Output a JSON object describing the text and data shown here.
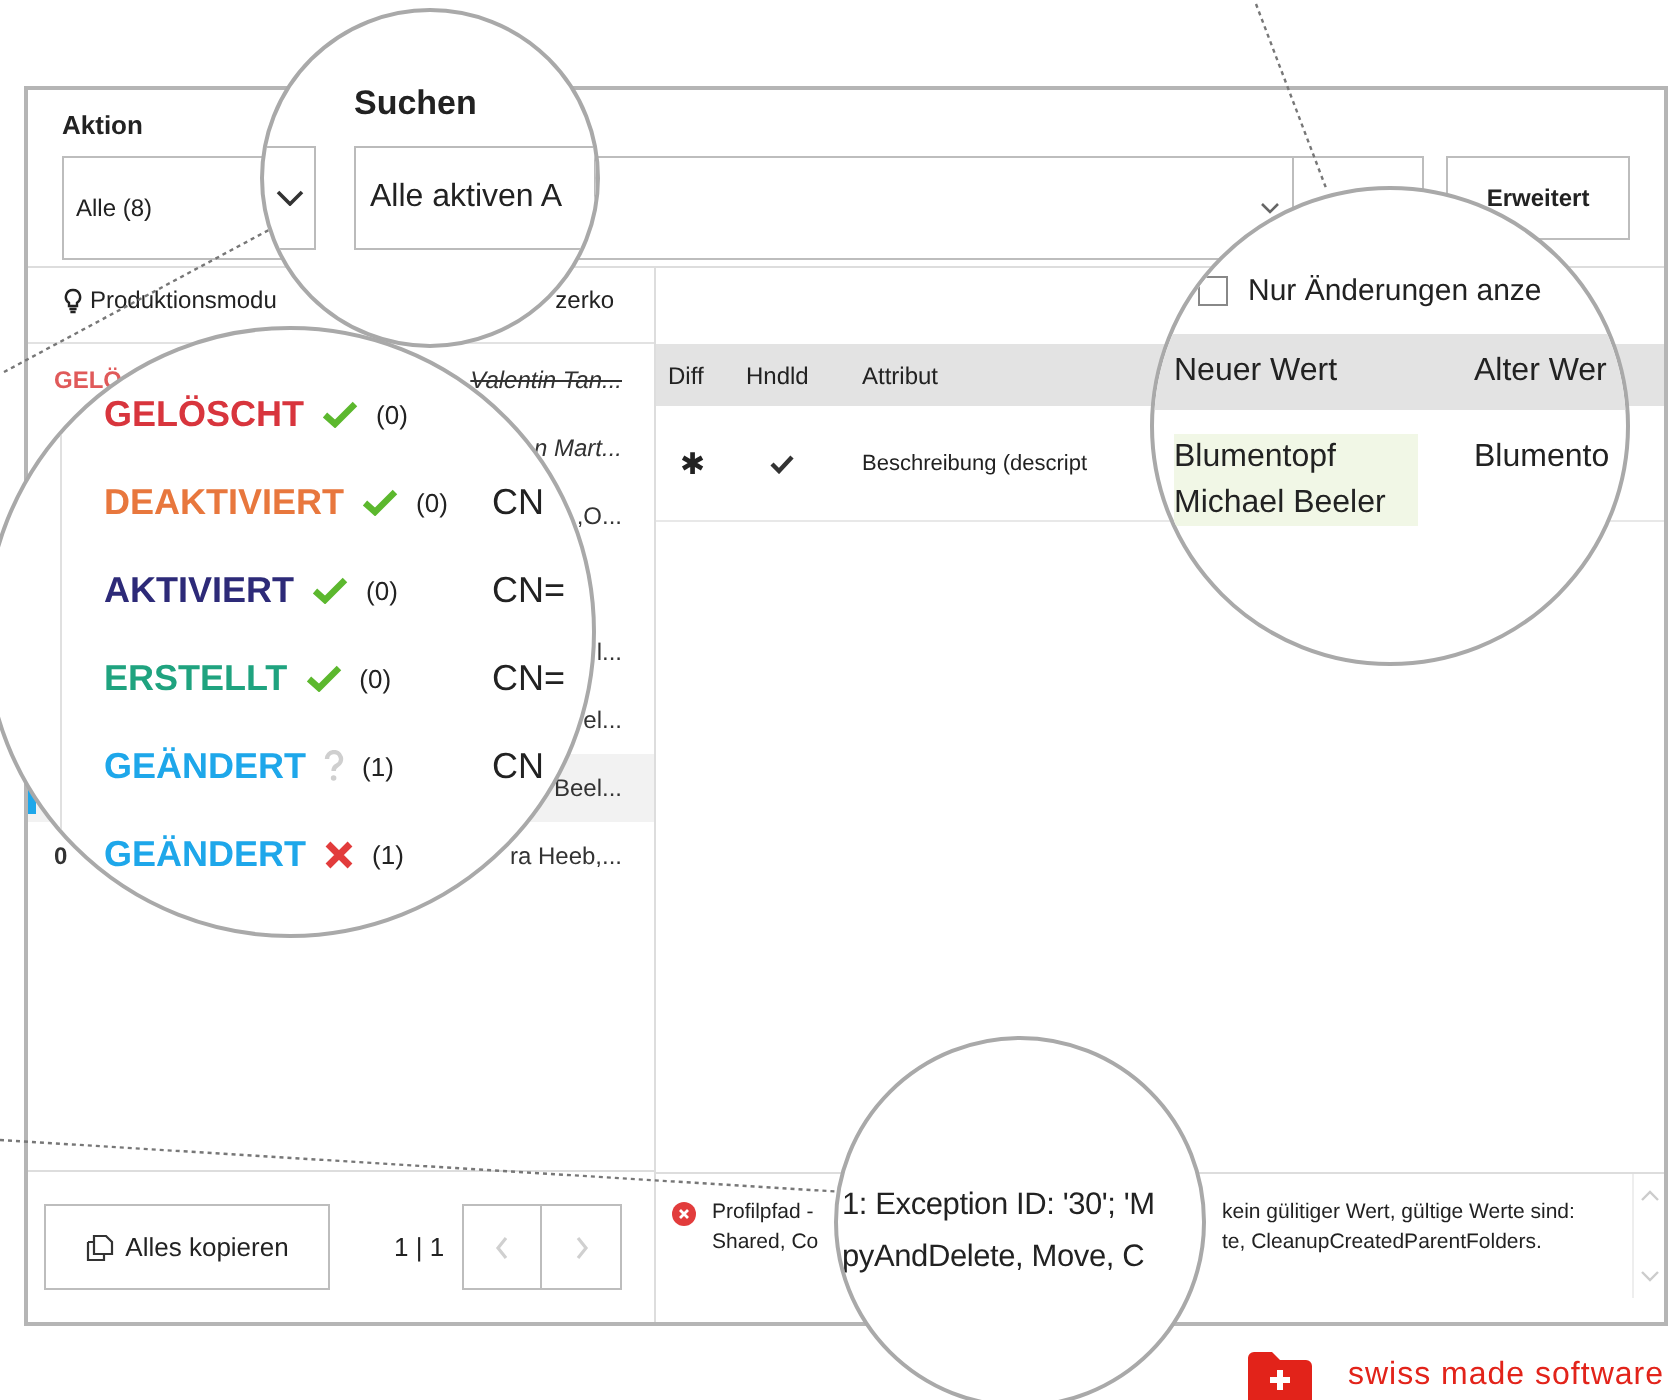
{
  "toolbar": {
    "action_label": "Aktion",
    "action_value": "Alle (8)",
    "advanced_button": "Erweitert"
  },
  "list_header": {
    "module": "Produktionsmodu",
    "user": "zerko"
  },
  "list_rows": [
    {
      "status_fragment": "GELÖ",
      "kind": "deleted",
      "subject": "Valentin Tan...",
      "selected": false
    },
    {
      "kind": "italic",
      "subject": "n Mart...",
      "selected": false
    },
    {
      "kind": "normal",
      "subject": ",O...",
      "selected": false
    },
    {
      "selected": false
    },
    {
      "kind": "normal",
      "subject": "l...",
      "selected": false
    },
    {
      "kind": "normal",
      "subject": "el...",
      "selected": false
    },
    {
      "kind": "normal",
      "subject": "Beel...",
      "selected": true
    },
    {
      "status_fragment": "0",
      "kind": "normal",
      "subject": "ra Heeb,...",
      "selected": false
    }
  ],
  "pager": {
    "copy_button": "Alles kopieren",
    "page": "1 | 1",
    "prev_disabled": true,
    "next_disabled": true
  },
  "detail_table": {
    "columns": [
      "Diff",
      "Hndld",
      "Attribut"
    ],
    "rows": [
      {
        "diff": "✱",
        "handled": true,
        "attribute": "Beschreibung (descript"
      }
    ]
  },
  "message": {
    "kind": "error",
    "line_1_start": "Profilpfad -",
    "line_1_end": "kein gülitiger Wert, gültige Werte sind:",
    "line_2_start": "Shared, Co",
    "line_2_end": "te, CleanupCreatedParentFolders."
  },
  "magnifier_search": {
    "label": "Suchen",
    "value": "Alle aktiven A"
  },
  "magnifier_actions": {
    "items": [
      {
        "label": "GELÖSCHT",
        "color": "#d8353d",
        "kind": "check",
        "count": "(0)"
      },
      {
        "label": "DEAKTIVIERT",
        "color": "#e8773d",
        "kind": "check",
        "count": "(0)",
        "subject": "CN"
      },
      {
        "label": "AKTIVIERT",
        "color": "#2d2a78",
        "kind": "check",
        "count": "(0)",
        "subject": "CN="
      },
      {
        "label": "ERSTELLT",
        "color": "#1fa37f",
        "kind": "check",
        "count": "(0)",
        "subject": "CN="
      },
      {
        "label": "GEÄNDERT",
        "color": "#1ea7ea",
        "kind": "question",
        "count": "(1)",
        "subject": "CN"
      },
      {
        "label": "GEÄNDERT",
        "color": "#1ea7ea",
        "kind": "cross",
        "count": "(1)"
      }
    ]
  },
  "magnifier_changes": {
    "checkbox": {
      "label": "Nur Änderungen anze",
      "checked": false
    },
    "columns": [
      "Neuer Wert",
      "Alter Wer"
    ],
    "new_value": "Blumentopf Michael Beeler",
    "old_value": "Blumento"
  },
  "magnifier_message": {
    "lines": [
      "1: Exception ID: '30'; 'M",
      "pyAndDelete, Move, C"
    ]
  },
  "logo": {
    "text": "swiss made software"
  }
}
